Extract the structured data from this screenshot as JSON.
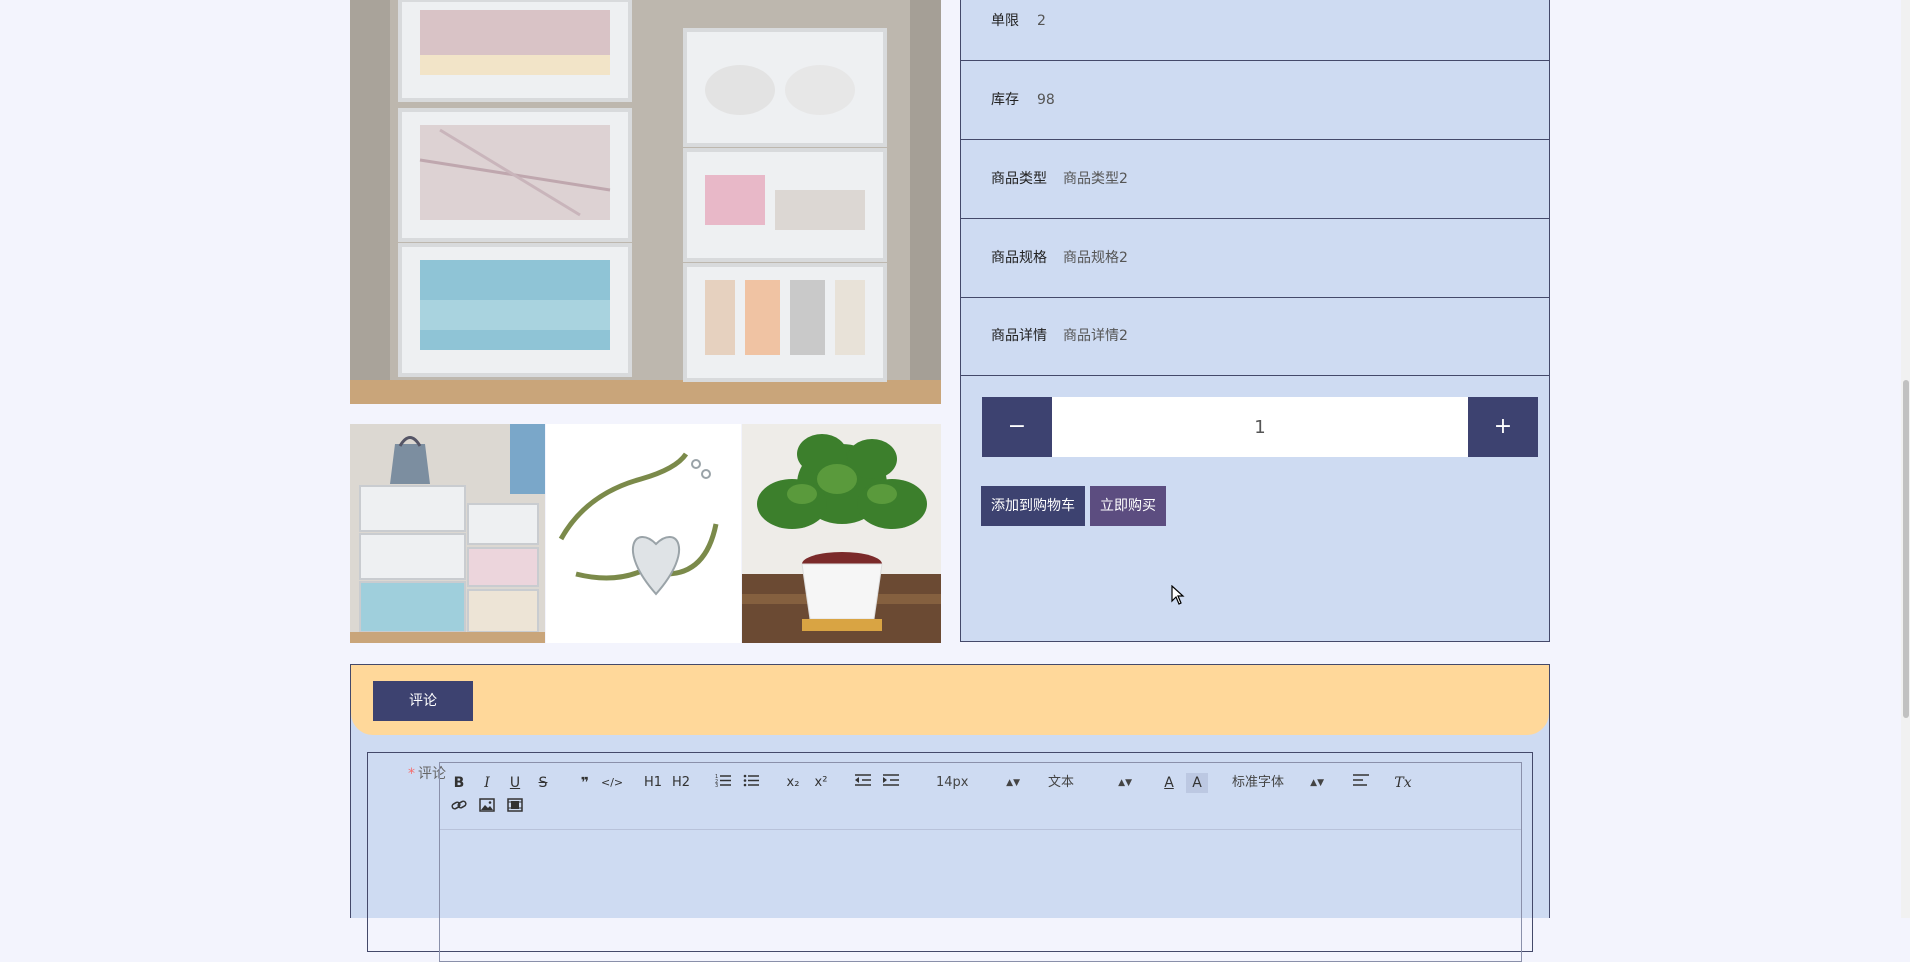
{
  "product": {
    "info_rows": [
      {
        "label": "单限",
        "value": "2"
      },
      {
        "label": "库存",
        "value": "98"
      },
      {
        "label": "商品类型",
        "value": "商品类型2"
      },
      {
        "label": "商品规格",
        "value": "商品规格2"
      },
      {
        "label": "商品详情",
        "value": "商品详情2"
      }
    ],
    "quantity": {
      "minus": "−",
      "value": "1",
      "plus": "+"
    },
    "add_to_cart": "添加到购物车",
    "buy_now": "立即购买"
  },
  "comments": {
    "tab_label": "评论",
    "required_mark": "*",
    "field_label": "评论",
    "editor": {
      "font_size": "14px",
      "header": "文本",
      "font_family": "标准字体",
      "buttons": [
        "B",
        "I",
        "U",
        "S",
        "❞",
        "</>",
        "H1",
        "H2",
        "ordered-list",
        "bullet-list",
        "x₂",
        "x²",
        "indent-decrease",
        "indent-increase",
        "A",
        "A",
        "align",
        "Tx",
        "link",
        "image",
        "video"
      ]
    }
  },
  "colors": {
    "accent": "#3d4270",
    "buy": "#5c4d80",
    "panel": "#cedbf2",
    "comment_header": "#ffd89a",
    "background": "#f3f4fd"
  }
}
